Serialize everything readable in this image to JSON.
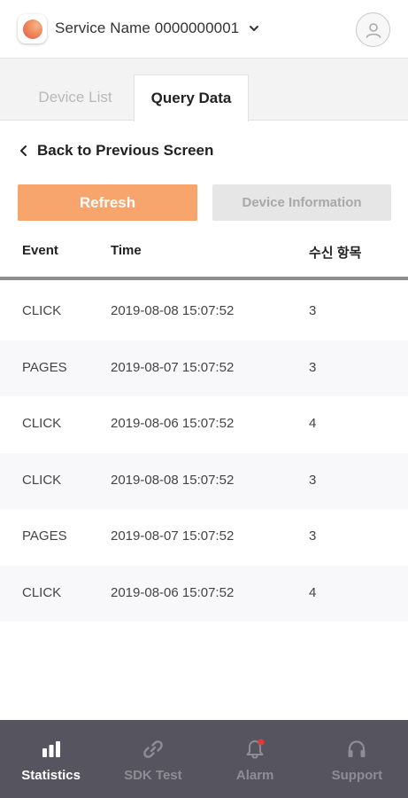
{
  "header": {
    "service_name": "Service Name 0000000001",
    "logo_icon": "app-logo-icon",
    "dropdown_icon": "chevron-down-icon",
    "profile_icon": "user-icon"
  },
  "tabs": [
    {
      "label": "Device List",
      "active": false
    },
    {
      "label": "Query Data",
      "active": true
    }
  ],
  "back": {
    "label": "Back to Previous Screen",
    "icon": "chevron-left-icon"
  },
  "buttons": {
    "refresh": "Refresh",
    "device_info": "Device Information"
  },
  "table": {
    "headers": {
      "event": "Event",
      "time": "Time",
      "count": "수신 항목"
    },
    "rows": [
      {
        "event": "CLICK",
        "time": "2019-08-08 15:07:52",
        "count": "3"
      },
      {
        "event": "PAGES",
        "time": "2019-08-07 15:07:52",
        "count": "3"
      },
      {
        "event": "CLICK",
        "time": "2019-08-06 15:07:52",
        "count": "4"
      },
      {
        "event": "CLICK",
        "time": "2019-08-08 15:07:52",
        "count": "3"
      },
      {
        "event": "PAGES",
        "time": "2019-08-07 15:07:52",
        "count": "3"
      },
      {
        "event": "CLICK",
        "time": "2019-08-06 15:07:52",
        "count": "4"
      }
    ]
  },
  "nav": [
    {
      "label": "Statistics",
      "icon": "bar-chart-icon",
      "active": true
    },
    {
      "label": "SDK Test",
      "icon": "link-icon",
      "active": false
    },
    {
      "label": "Alarm",
      "icon": "bell-icon",
      "active": false,
      "badge": true
    },
    {
      "label": "Support",
      "icon": "headset-icon",
      "active": false
    }
  ],
  "colors": {
    "accent": "#f7a56d",
    "nav_background": "#56545e",
    "alarm_badge": "#e53935"
  }
}
